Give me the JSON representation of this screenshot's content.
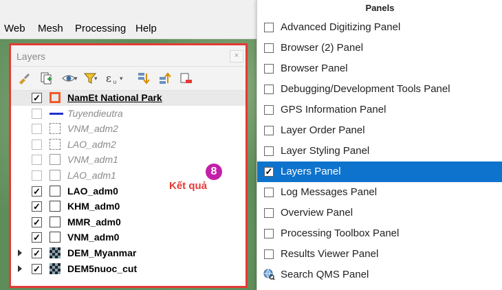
{
  "menu": {
    "items": [
      "Web",
      "Mesh",
      "Processing",
      "Help"
    ]
  },
  "layers_dock": {
    "title": "Layers",
    "close_glyph": "×",
    "toolbar_icons": [
      "style-brush-icon",
      "add-group-icon",
      "eye-icon",
      "filter-icon",
      "expression-filter-icon",
      "expand-all-icon",
      "collapse-all-icon",
      "remove-layer-icon"
    ],
    "layers": [
      {
        "name": "NamEt National Park",
        "checked": true,
        "symbol": "red-box",
        "bold": true,
        "underline": true,
        "italic": false,
        "selected": true,
        "expander": false
      },
      {
        "name": "Tuyendieutra",
        "checked": false,
        "symbol": "blue-line",
        "bold": false,
        "italic": true,
        "selected": false,
        "expander": false
      },
      {
        "name": "VNM_adm2",
        "checked": false,
        "symbol": "dashed-box",
        "bold": false,
        "italic": true,
        "selected": false,
        "expander": false
      },
      {
        "name": "LAO_adm2",
        "checked": false,
        "symbol": "dashed-box",
        "bold": false,
        "italic": true,
        "selected": false,
        "expander": false
      },
      {
        "name": "VNM_adm1",
        "checked": false,
        "symbol": "gray-box",
        "bold": false,
        "italic": true,
        "selected": false,
        "expander": false
      },
      {
        "name": "LAO_adm1",
        "checked": false,
        "symbol": "gray-box",
        "bold": false,
        "italic": true,
        "selected": false,
        "expander": false
      },
      {
        "name": "LAO_adm0",
        "checked": true,
        "symbol": "box",
        "bold": true,
        "italic": false,
        "selected": false,
        "expander": false
      },
      {
        "name": "KHM_adm0",
        "checked": true,
        "symbol": "box",
        "bold": true,
        "italic": false,
        "selected": false,
        "expander": false
      },
      {
        "name": "MMR_adm0",
        "checked": true,
        "symbol": "box",
        "bold": true,
        "italic": false,
        "selected": false,
        "expander": false
      },
      {
        "name": "VNM_adm0",
        "checked": true,
        "symbol": "box",
        "bold": true,
        "italic": false,
        "selected": false,
        "expander": false
      },
      {
        "name": "DEM_Myanmar",
        "checked": true,
        "symbol": "raster",
        "bold": true,
        "italic": false,
        "selected": false,
        "expander": true
      },
      {
        "name": "DEM5nuoc_cut",
        "checked": true,
        "symbol": "raster",
        "bold": true,
        "italic": false,
        "selected": false,
        "expander": true
      }
    ],
    "annotation": "Kết quả"
  },
  "panels_menu": {
    "header": "Panels",
    "items": [
      {
        "label": "Advanced Digitizing Panel",
        "checked": false,
        "active": false
      },
      {
        "label": "Browser (2) Panel",
        "checked": false,
        "active": false
      },
      {
        "label": "Browser Panel",
        "checked": false,
        "active": false
      },
      {
        "label": "Debugging/Development Tools Panel",
        "checked": false,
        "active": false
      },
      {
        "label": "GPS Information Panel",
        "checked": false,
        "active": false
      },
      {
        "label": "Layer Order Panel",
        "checked": false,
        "active": false
      },
      {
        "label": "Layer Styling Panel",
        "checked": false,
        "active": false
      },
      {
        "label": "Layers Panel",
        "checked": true,
        "active": true
      },
      {
        "label": "Log Messages Panel",
        "checked": false,
        "active": false
      },
      {
        "label": "Overview Panel",
        "checked": false,
        "active": false
      },
      {
        "label": "Processing Toolbox Panel",
        "checked": false,
        "active": false
      },
      {
        "label": "Results Viewer Panel",
        "checked": false,
        "active": false
      },
      {
        "label": "Search QMS Panel",
        "checked": false,
        "active": false,
        "icon": "globe-search-icon"
      }
    ],
    "step_badge": "8"
  },
  "colors": {
    "highlight": "#0e73cc",
    "annotation_red": "#e53935",
    "badge_magenta": "#c41fa8"
  }
}
